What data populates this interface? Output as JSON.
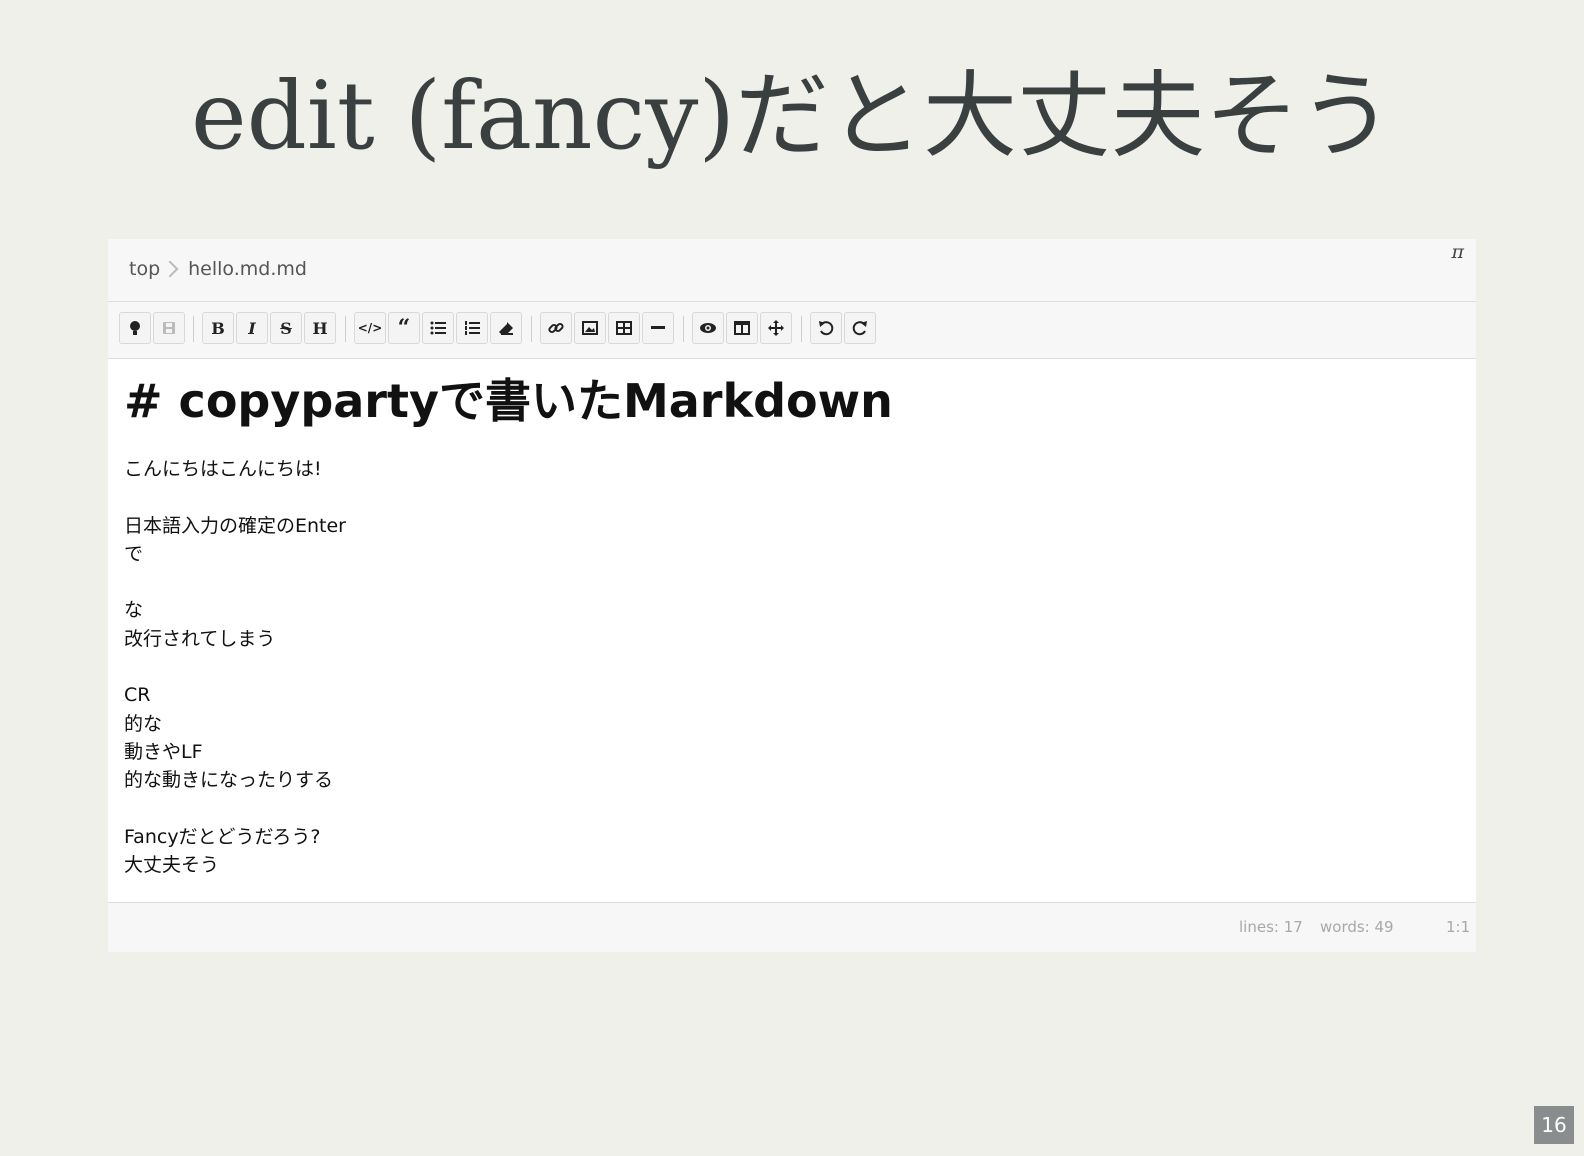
{
  "slide": {
    "title": "edit (fancy)だと大丈夫そう",
    "page_number": "16"
  },
  "editor": {
    "breadcrumb": {
      "root": "top",
      "file": "hello.md.md"
    },
    "pi_symbol": "π",
    "toolbar": {
      "buttons": [
        {
          "name": "hint-icon",
          "glyph": "●"
        },
        {
          "name": "save-icon",
          "glyph": "▪"
        },
        {
          "name": "bold-icon",
          "glyph": "B"
        },
        {
          "name": "italic-icon",
          "glyph": "I"
        },
        {
          "name": "strikethrough-icon",
          "glyph": "S"
        },
        {
          "name": "heading-icon",
          "glyph": "H"
        },
        {
          "name": "code-icon",
          "glyph": "</>"
        },
        {
          "name": "quote-icon",
          "glyph": "“"
        },
        {
          "name": "unordered-list-icon",
          "glyph": "☰"
        },
        {
          "name": "ordered-list-icon",
          "glyph": "☰"
        },
        {
          "name": "eraser-icon",
          "glyph": "⌫"
        },
        {
          "name": "link-icon",
          "glyph": "🔗"
        },
        {
          "name": "image-icon",
          "glyph": "▣"
        },
        {
          "name": "table-icon",
          "glyph": "⊞"
        },
        {
          "name": "horizontal-rule-icon",
          "glyph": "—"
        },
        {
          "name": "preview-icon",
          "glyph": "◉"
        },
        {
          "name": "side-by-side-icon",
          "glyph": "◫"
        },
        {
          "name": "fullscreen-icon",
          "glyph": "✥"
        },
        {
          "name": "undo-icon",
          "glyph": "↶"
        },
        {
          "name": "redo-icon",
          "glyph": "↷"
        }
      ]
    },
    "content": {
      "heading": "# copypartyで書いたMarkdown",
      "lines": [
        "こんにちはこんにちは!",
        "",
        "日本語入力の確定のEnter",
        "で",
        "",
        "な",
        "改行されてしまう",
        "",
        "CR",
        "的な",
        "動きやLF",
        "的な動きになったりする",
        "",
        "Fancyだとどうだろう?",
        "大丈夫そう"
      ]
    },
    "status": {
      "lines": "lines: 17",
      "words": "words: 49",
      "cursor": "1:1"
    }
  },
  "colors": {
    "background": "#f0f0eb",
    "title": "#3a3f3f",
    "page_badge": "#8a8d8d"
  }
}
